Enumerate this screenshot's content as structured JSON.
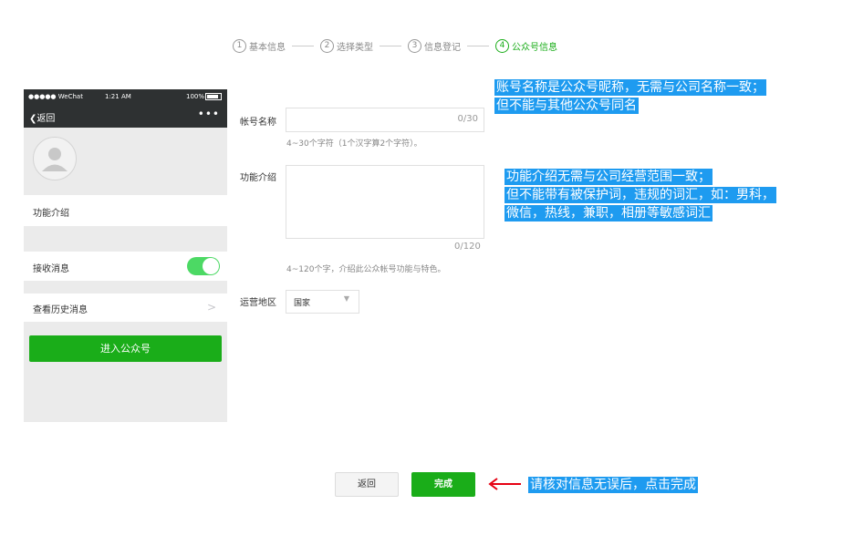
{
  "steps": [
    {
      "num": "1",
      "label": "基本信息",
      "active": false
    },
    {
      "num": "2",
      "label": "选择类型",
      "active": false
    },
    {
      "num": "3",
      "label": "信息登记",
      "active": false
    },
    {
      "num": "4",
      "label": "公众号信息",
      "active": true
    }
  ],
  "phone": {
    "carrier": "●●●●● WeChat",
    "time": "1:21 AM",
    "battery": "100%",
    "back_label": "返回",
    "more": "•••",
    "func_intro_label": "功能介绍",
    "receive_msg_label": "接收消息",
    "history_label": "查看历史消息",
    "enter_label": "进入公众号"
  },
  "form": {
    "account_name_label": "帐号名称",
    "account_name_counter": "0/30",
    "account_name_hint": "4~30个字符（1个汉字算2个字符）。",
    "intro_label": "功能介绍",
    "intro_counter": "0/120",
    "intro_hint": "4~120个字，介绍此公众帐号功能与特色。",
    "region_label": "运营地区",
    "region_value": "国家",
    "region_arrow": "▼"
  },
  "notes": {
    "name_note_1": "账号名称是公众号昵称，无需与公司名称一致；",
    "name_note_2": "但不能与其他公众号同名",
    "intro_note_1": "功能介绍无需与公司经营范围一致；",
    "intro_note_2": "但不能带有被保护词，违规的词汇，如：男科，",
    "intro_note_3": "微信，热线，兼职，相册等敏感词汇",
    "finish_note": "请核对信息无误后，点击完成"
  },
  "buttons": {
    "back_label": "返回",
    "done_label": "完成"
  },
  "colors": {
    "accent_green": "#1aad19",
    "note_blue": "#1e9bf0",
    "arrow_red": "#e60012",
    "nav_dark": "#2e3132"
  }
}
